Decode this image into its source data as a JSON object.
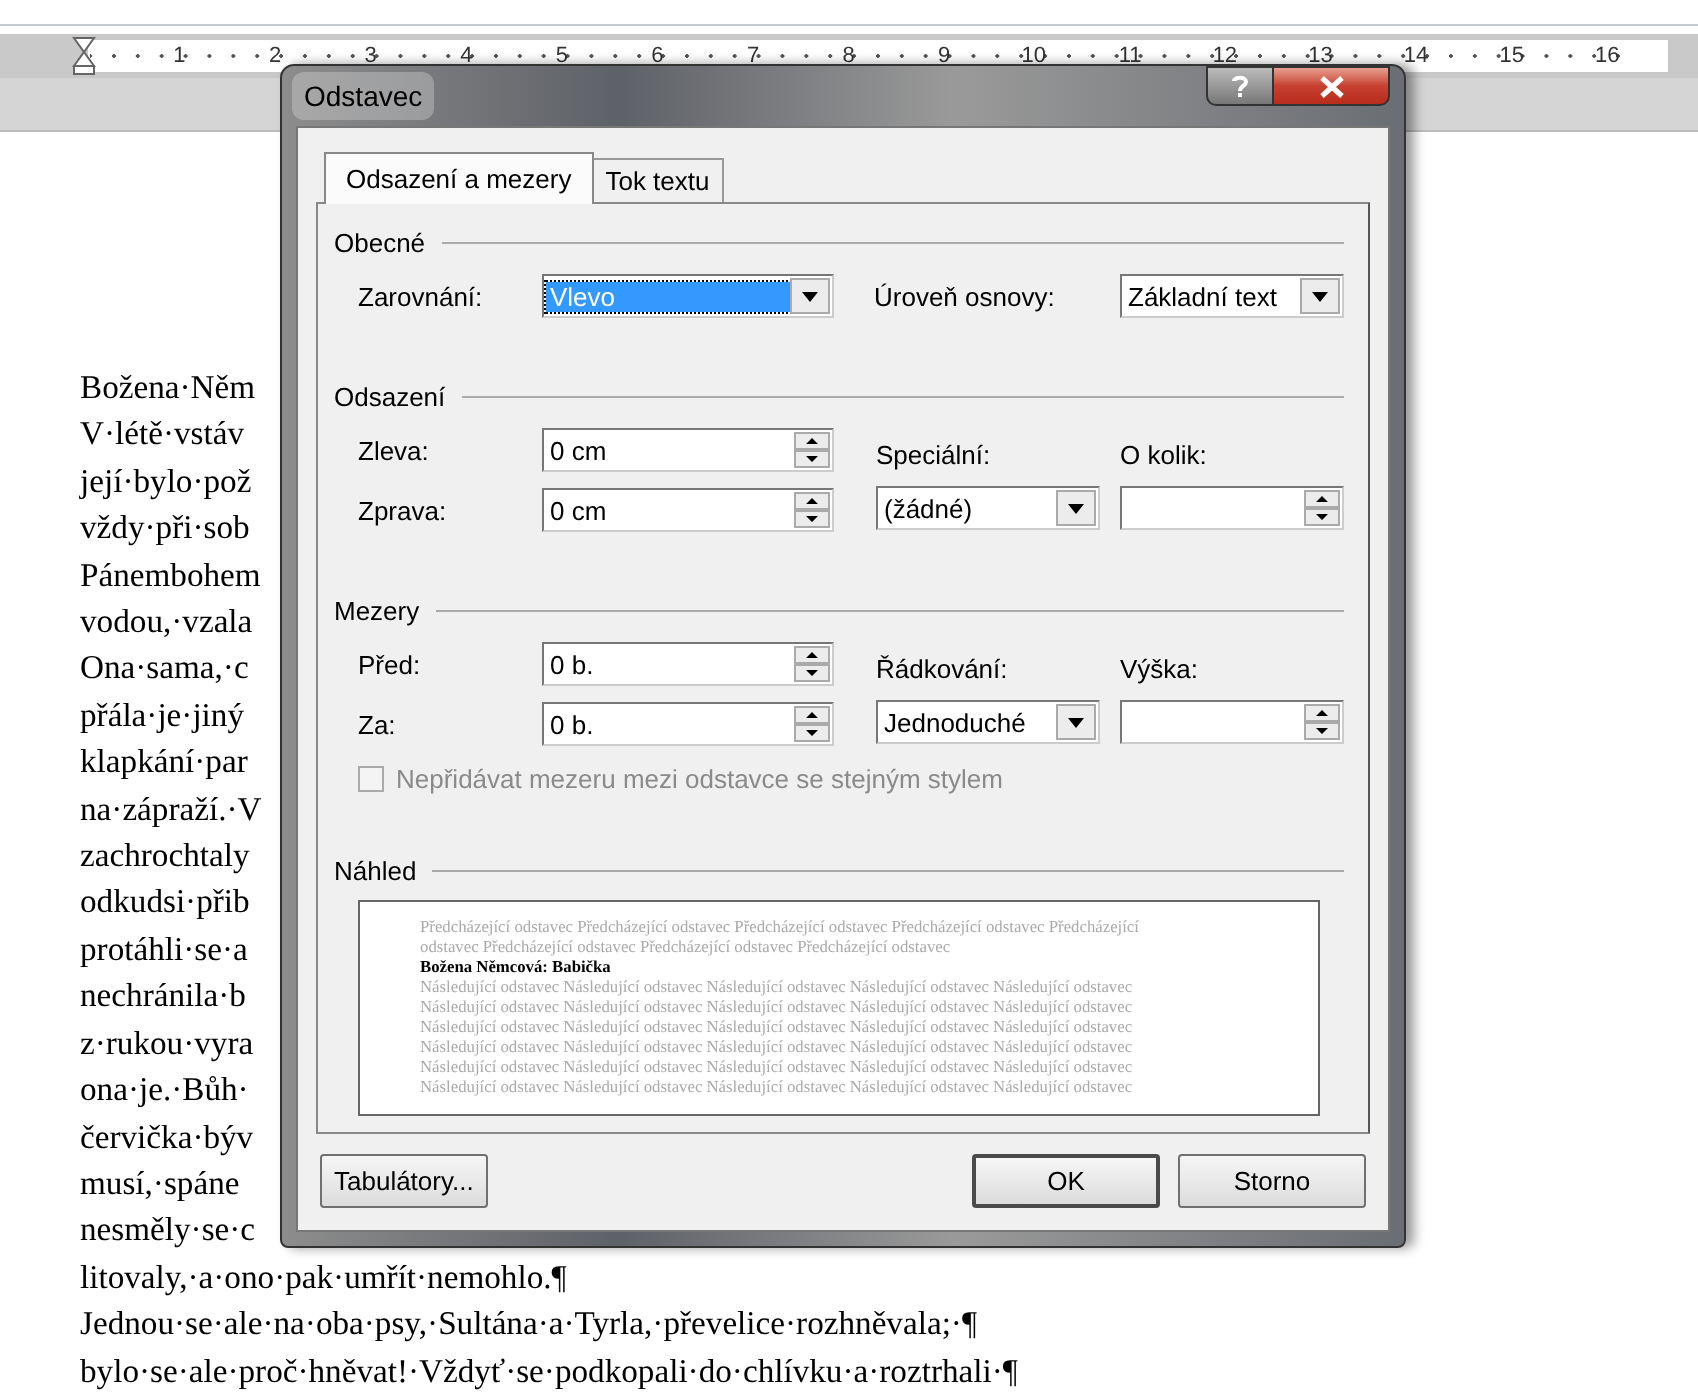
{
  "ruler": {
    "numbers": [
      "1",
      "2",
      "3",
      "4",
      "5",
      "6",
      "7",
      "8",
      "9",
      "10",
      "11",
      "12",
      "13",
      "14",
      "15",
      "16"
    ]
  },
  "document": {
    "lines": [
      "Božena·Něm",
      "V·létě·vstáv",
      "její·bylo·pož",
      "vždy·při·sob",
      "Pánembohem",
      "vodou,·vzala",
      "Ona·sama,·c",
      "přála·je·jiný",
      "klapkání·par",
      "na·zápraží.·V",
      "zachrochtaly",
      "odkudsi·přib",
      "protáhli·se·a",
      "nechránila·b",
      "z·rukou·vyra",
      "ona·je.·Bůh·",
      "červička·býv",
      "musí,·spáne",
      "nesměly·se·c",
      "litovaly,·a·ono·pak·umřít·nemohlo.¶",
      "Jednou·se·ale·na·oba·psy,·Sultána·a·Tyrla,·převelice·rozhněvala;·¶",
      "bylo·se·ale·proč·hněvat!·Vždyť·se·podkopali·do·chlívku·a·roztrhali·¶"
    ]
  },
  "dialog": {
    "title": "Odstavec",
    "tabs": [
      {
        "label": "Odsazení a mezery",
        "selected": true
      },
      {
        "label": "Tok textu",
        "selected": false
      }
    ],
    "sections": [
      {
        "heading": "Obecné",
        "kind": "inline",
        "left": [
          {
            "label": "Zarovnání:",
            "value": "Vlevo",
            "kind": "dropdown",
            "highlighted": true
          }
        ],
        "right": [
          {
            "label": "Úroveň osnovy:",
            "value": "Základní text",
            "kind": "dropdown",
            "highlighted": false
          }
        ]
      },
      {
        "heading": "Odsazení",
        "kind": "stacked",
        "left": [
          {
            "label": "Zleva:",
            "value": "0 cm",
            "kind": "spinner"
          },
          {
            "label": "Zprava:",
            "value": "0 cm",
            "kind": "spinner"
          }
        ],
        "right": [
          {
            "label": "Speciální:",
            "value": "(žádné)",
            "kind": "dropdown",
            "highlighted": false
          },
          {
            "label": "O kolik:",
            "kind": "spinner"
          }
        ]
      },
      {
        "heading": "Mezery",
        "kind": "stacked",
        "left": [
          {
            "label": "Před:",
            "value": "0 b.",
            "kind": "spinner"
          },
          {
            "label": "Za:",
            "value": "0 b.",
            "kind": "spinner"
          }
        ],
        "right": [
          {
            "label": "Řádkování:",
            "value": "Jednoduché",
            "kind": "dropdown",
            "highlighted": false
          },
          {
            "label": "Výška:",
            "kind": "spinner"
          }
        ],
        "checkbox": {
          "label": "Nepřidávat mezeru mezi odstavce se stejným stylem",
          "checked": false,
          "disabled": true
        }
      }
    ],
    "preview": {
      "heading": "Náhled",
      "lines": [
        {
          "kind": "previous",
          "text": "Předcházející odstavec Předcházející odstavec Předcházející odstavec Předcházející odstavec Předcházející"
        },
        {
          "kind": "previous",
          "text": "odstavec Předcházející odstavec Předcházející odstavec Předcházející odstavec"
        },
        {
          "kind": "sample",
          "text": "Božena Němcová: Babička"
        },
        {
          "kind": "following",
          "text": "Následující odstavec Následující odstavec Následující odstavec Následující odstavec Následující odstavec"
        },
        {
          "kind": "following",
          "text": "Následující odstavec Následující odstavec Následující odstavec Následující odstavec Následující odstavec"
        },
        {
          "kind": "following",
          "text": "Následující odstavec Následující odstavec Následující odstavec Následující odstavec Následující odstavec"
        },
        {
          "kind": "following",
          "text": "Následující odstavec Následující odstavec Následující odstavec Následující odstavec Následující odstavec"
        },
        {
          "kind": "following",
          "text": "Následující odstavec Následující odstavec Následující odstavec Následující odstavec Následující odstavec"
        },
        {
          "kind": "following",
          "text": "Následující odstavec Následující odstavec Následující odstavec Následující odstavec Následující odstavec"
        }
      ]
    },
    "buttons": [
      {
        "label": "Tabulátory...",
        "kind": "left",
        "default": false
      },
      {
        "label": "OK",
        "kind": "right",
        "default": true
      },
      {
        "label": "Storno",
        "kind": "right",
        "default": false
      }
    ]
  }
}
